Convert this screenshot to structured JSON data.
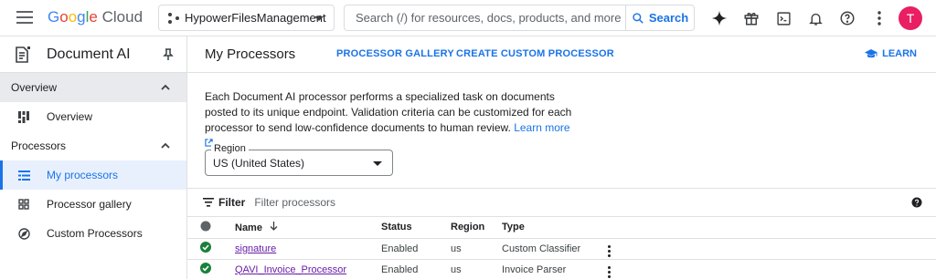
{
  "topbar": {
    "logo_google": [
      "G",
      "o",
      "o",
      "g",
      "l",
      "e"
    ],
    "logo_cloud": "Cloud",
    "project": "HypowerFilesManagement",
    "search_placeholder": "Search (/) for resources, docs, products, and more",
    "search_button": "Search",
    "avatar_initial": "T",
    "icons": [
      "gemini-icon",
      "gift-icon",
      "terminal-icon",
      "bell-icon",
      "help-icon",
      "more-vert-icon"
    ]
  },
  "sidebar": {
    "product_title": "Document AI",
    "sections": [
      {
        "label": "Overview",
        "items": [
          {
            "label": "Overview",
            "icon": "dashboard-icon"
          }
        ]
      },
      {
        "label": "Processors",
        "items": [
          {
            "label": "My processors",
            "icon": "list-icon",
            "selected": true
          },
          {
            "label": "Processor gallery",
            "icon": "grid-icon"
          },
          {
            "label": "Custom Processors",
            "icon": "explore-icon"
          }
        ]
      }
    ]
  },
  "main": {
    "title": "My Processors",
    "links": [
      "PROCESSOR GALLERY",
      "CREATE CUSTOM PROCESSOR"
    ],
    "learn": "LEARN",
    "description": "Each Document AI processor performs a specialized task on documents posted to its unique endpoint. Validation criteria can be customized for each processor to send low-confidence documents to human review.",
    "learn_more": "Learn more",
    "region_label": "Region",
    "region_value": "US (United States)",
    "filter_label": "Filter",
    "filter_placeholder": "Filter processors",
    "table": {
      "headers": [
        "Name",
        "Status",
        "Region",
        "Type"
      ],
      "rows": [
        {
          "name": "signature",
          "status": "Enabled",
          "region": "us",
          "type": "Custom Classifier"
        },
        {
          "name": "QAVI_Invoice_Processor",
          "status": "Enabled",
          "region": "us",
          "type": "Invoice Parser"
        }
      ]
    }
  },
  "colors": {
    "accent": "#1a73e8",
    "success": "#188038",
    "avatar": "#e91e63"
  }
}
